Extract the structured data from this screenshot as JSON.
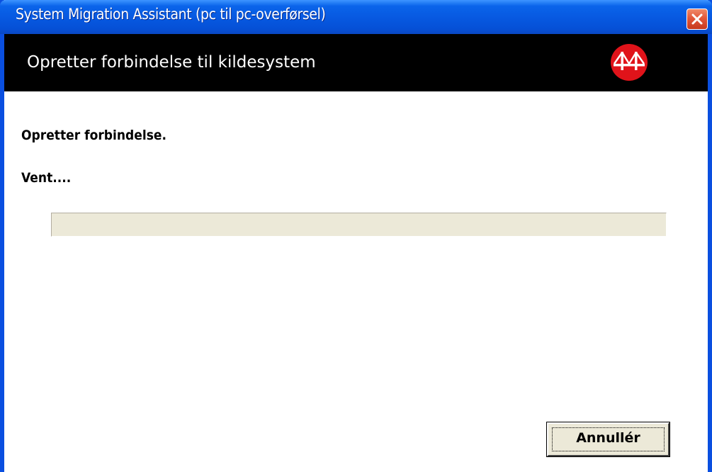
{
  "window": {
    "title": "System Migration Assistant (pc til pc-overførsel)",
    "close_icon": "close-icon"
  },
  "header": {
    "title": "Opretter forbindelse til kildesystem",
    "logo_icon": "bridge-logo-icon"
  },
  "content": {
    "status_line": "Opretter forbindelse.",
    "wait_line": "Vent....",
    "progress_fraction": 0
  },
  "buttons": {
    "cancel_label": "Annullér"
  },
  "colors": {
    "titlebar_blue": "#0a64ea",
    "header_black": "#000000",
    "logo_red": "#e0131a",
    "close_red": "#e2573a",
    "progress_track": "#ece9d8",
    "button_face": "#ece9d8"
  }
}
